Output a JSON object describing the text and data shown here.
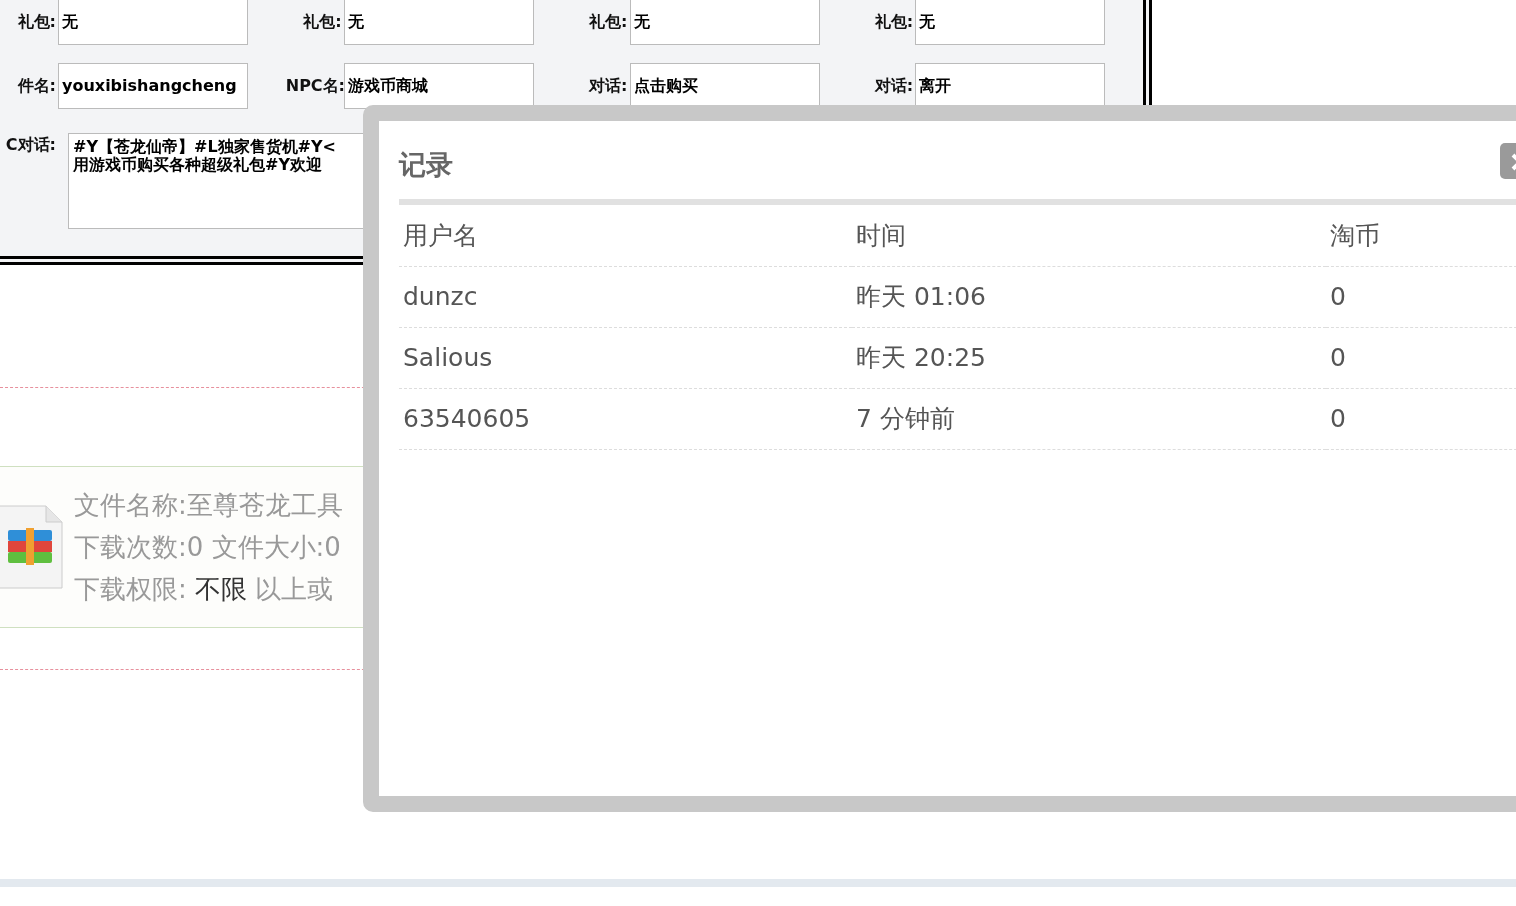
{
  "form": {
    "rows": [
      {
        "fields": [
          {
            "label": "礼包:",
            "value": "无"
          },
          {
            "label": "礼包:",
            "value": "无"
          },
          {
            "label": "礼包:",
            "value": "无"
          },
          {
            "label": "礼包:",
            "value": "无"
          }
        ]
      },
      {
        "fields": [
          {
            "label": "件名:",
            "value": "youxibishangcheng"
          },
          {
            "label": "NPC名:",
            "value": "游戏币商城"
          },
          {
            "label": "对话:",
            "value": "点击购买"
          },
          {
            "label": "对话:",
            "value": "离开"
          }
        ]
      }
    ],
    "dialog": {
      "label": "C对话:",
      "lines": [
        "#Y【苍龙仙帝】#L独家售货机#Y<",
        "用游戏币购买各种超级礼包#Y欢迎"
      ]
    }
  },
  "file_box": {
    "name_line": "文件名称:至尊苍龙工具",
    "stats_line": "下载次数:0  文件大小:0",
    "permission": {
      "label": "下载权限:",
      "value": "不限",
      "suffix": "以上或"
    }
  },
  "modal": {
    "title": "记录",
    "table": {
      "columns": [
        "用户名",
        "时间",
        "淘币"
      ],
      "rows": [
        [
          "dunzc",
          "昨天 01:06",
          "0"
        ],
        [
          "Salious",
          "昨天 20:25",
          "0"
        ],
        [
          "63540605",
          "7 分钟前",
          "0"
        ]
      ]
    }
  }
}
